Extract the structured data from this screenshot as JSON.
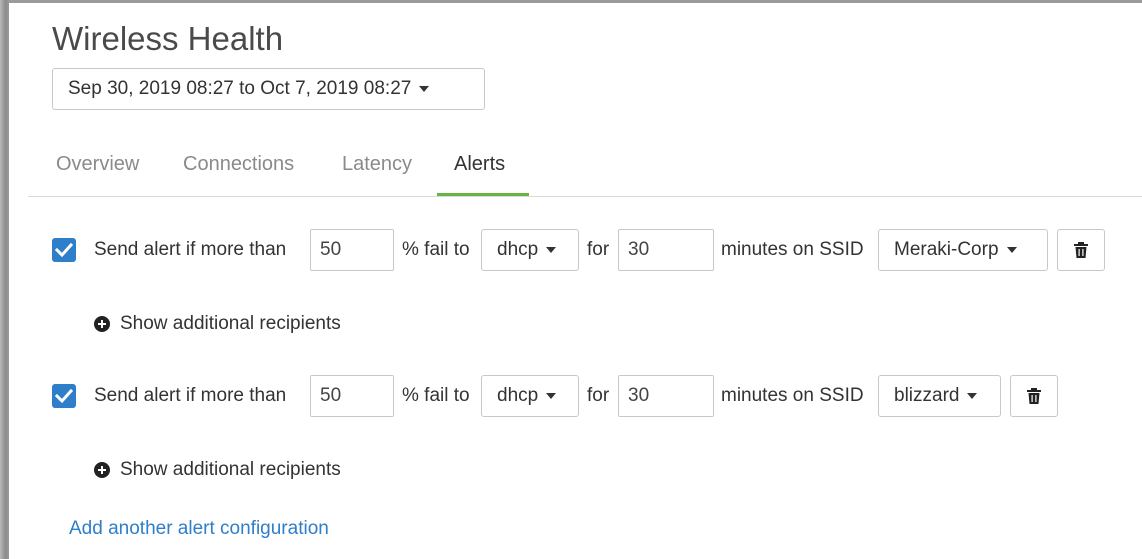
{
  "page": {
    "title": "Wireless Health"
  },
  "date_range": {
    "label": "Sep 30, 2019 08:27 to Oct 7, 2019 08:27"
  },
  "tabs": [
    {
      "label": "Overview",
      "active": false
    },
    {
      "label": "Connections",
      "active": false
    },
    {
      "label": "Latency",
      "active": false
    },
    {
      "label": "Alerts",
      "active": true
    }
  ],
  "alerts": [
    {
      "checked": true,
      "prefix": "Send alert if more than",
      "threshold": "50",
      "fail_text": "% fail to",
      "type": "dhcp",
      "for_text": "for",
      "minutes": "30",
      "ssid_text": "minutes on SSID",
      "ssid": "Meraki-Corp",
      "recipients_label": "Show additional recipients"
    },
    {
      "checked": true,
      "prefix": "Send alert if more than",
      "threshold": "50",
      "fail_text": "% fail to",
      "type": "dhcp",
      "for_text": "for",
      "minutes": "30",
      "ssid_text": "minutes on SSID",
      "ssid": "blizzard",
      "recipients_label": "Show additional recipients"
    }
  ],
  "add_link": "Add another alert configuration",
  "colors": {
    "accent": "#2f7ec9",
    "tab_underline": "#67b346"
  }
}
